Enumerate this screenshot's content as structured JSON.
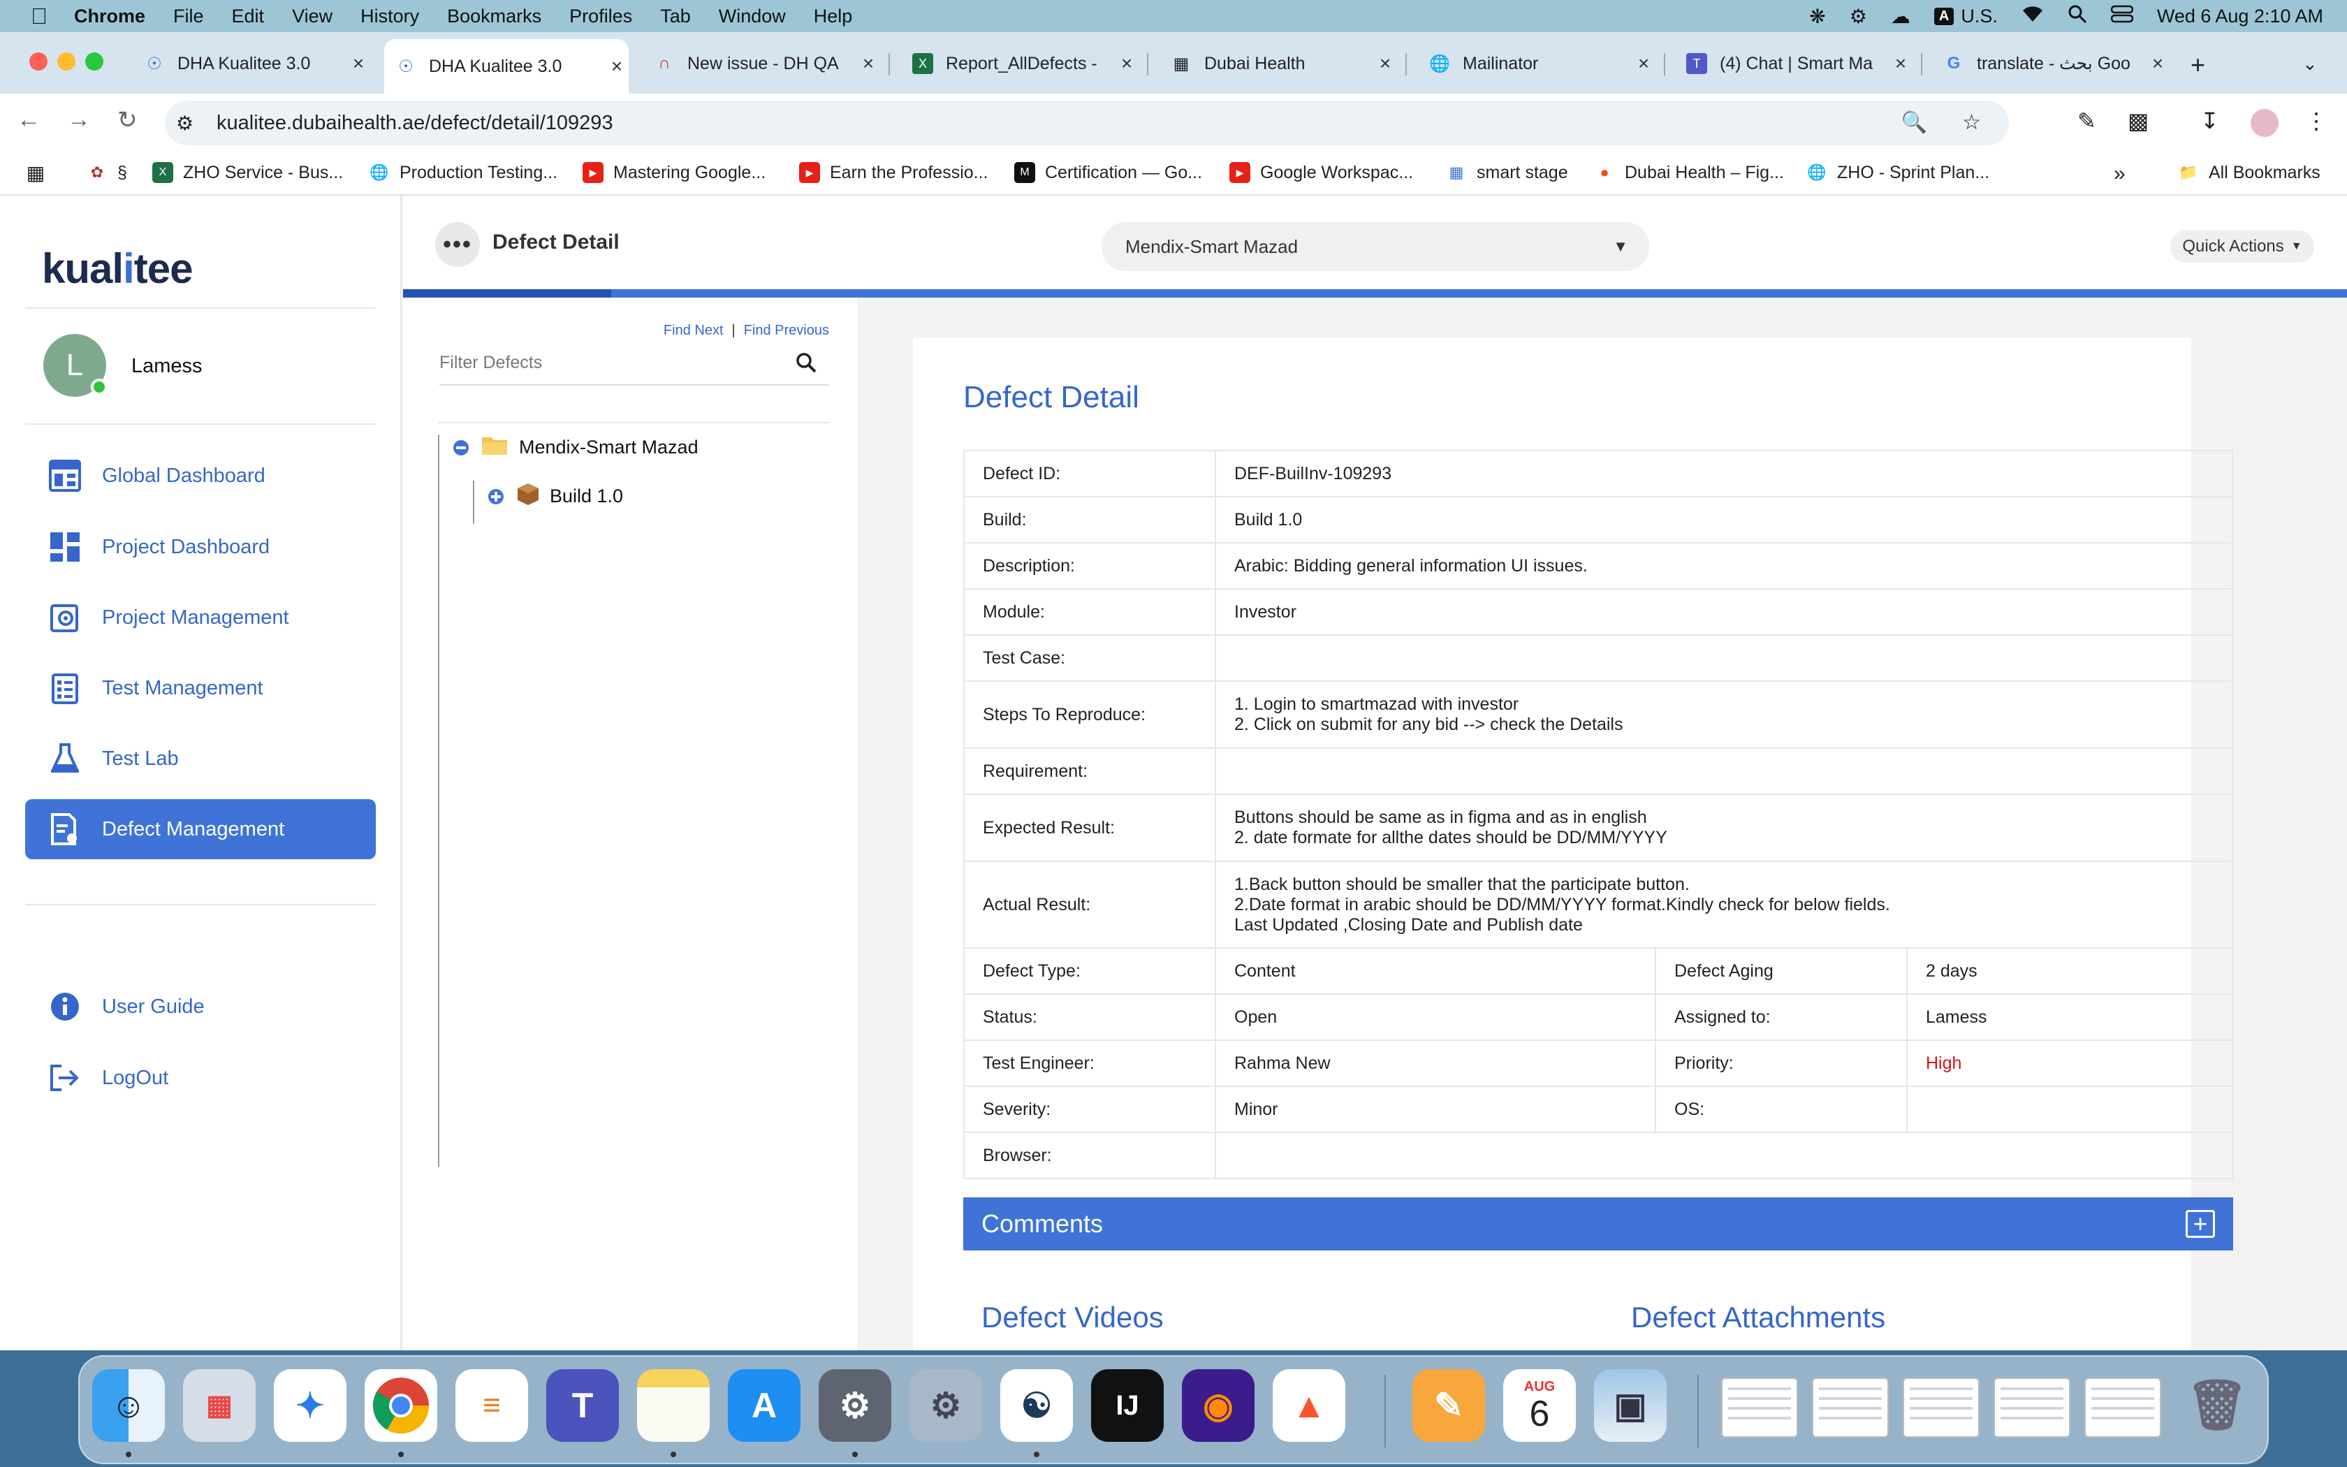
{
  "menubar": {
    "app": "Chrome",
    "items": [
      "File",
      "Edit",
      "View",
      "History",
      "Bookmarks",
      "Profiles",
      "Tab",
      "Window",
      "Help"
    ],
    "input_source": "A",
    "input_label": "U.S.",
    "datetime": "Wed 6 Aug  2:10 AM"
  },
  "tabs": [
    {
      "title": "DHA Kualitee 3.0",
      "icon": "kualitee-icon"
    },
    {
      "title": "DHA Kualitee 3.0",
      "icon": "kualitee-icon",
      "active": true
    },
    {
      "title": "New issue - DH QA",
      "icon": "issue-icon"
    },
    {
      "title": "Report_AllDefects -",
      "icon": "excel-icon"
    },
    {
      "title": "Dubai Health",
      "icon": "dubai-health-icon"
    },
    {
      "title": "Mailinator",
      "icon": "globe-icon"
    },
    {
      "title": "(4) Chat | Smart Ma",
      "icon": "teams-icon"
    },
    {
      "title": "translate - بحث Goo",
      "icon": "google-icon"
    }
  ],
  "address": {
    "url": "kualitee.dubaihealth.ae/defect/detail/109293"
  },
  "bookmarks": [
    {
      "label": "§",
      "icon": "flower-icon"
    },
    {
      "label": "ZHO Service - Bus...",
      "icon": "excel-icon"
    },
    {
      "label": "Production Testing...",
      "icon": "globe-icon"
    },
    {
      "label": "Mastering Google...",
      "icon": "youtube-icon"
    },
    {
      "label": "Earn the Professio...",
      "icon": "youtube-icon"
    },
    {
      "label": "Certification — Go...",
      "icon": "medium-icon"
    },
    {
      "label": "Google Workspac...",
      "icon": "youtube-icon"
    },
    {
      "label": "smart stage",
      "icon": "chart-icon"
    },
    {
      "label": "Dubai Health – Fig...",
      "icon": "figma-icon"
    },
    {
      "label": "ZHO - Sprint Plan...",
      "icon": "globe-icon"
    }
  ],
  "all_bookmarks": "All Bookmarks",
  "sidebar": {
    "logo_text_a": "kual",
    "logo_text_b": "i",
    "logo_text_c": "tee",
    "avatar_letter": "L",
    "user_name": "Lamess",
    "nav": [
      {
        "label": "Global Dashboard",
        "icon": "global-dashboard-icon"
      },
      {
        "label": "Project Dashboard",
        "icon": "project-dashboard-icon"
      },
      {
        "label": "Project Management",
        "icon": "project-management-icon"
      },
      {
        "label": "Test Management",
        "icon": "test-management-icon"
      },
      {
        "label": "Test Lab",
        "icon": "flask-icon"
      },
      {
        "label": "Defect Management",
        "icon": "defect-management-icon",
        "active": true
      }
    ],
    "footer": [
      {
        "label": "User Guide",
        "icon": "info-icon"
      },
      {
        "label": "LogOut",
        "icon": "logout-icon"
      }
    ]
  },
  "header": {
    "title": "Defect Detail",
    "project_selected": "Mendix-Smart Mazad",
    "quick_actions": "Quick Actions"
  },
  "tree": {
    "find_next": "Find Next",
    "separator": "|",
    "find_previous": "Find Previous",
    "filter_placeholder": "Filter Defects",
    "project": "Mendix-Smart Mazad",
    "build": "Build 1.0"
  },
  "detail": {
    "title": "Defect Detail",
    "defect_id_label": "Defect ID:",
    "defect_id": "DEF-BuilInv-109293",
    "build_label": "Build:",
    "build": "Build 1.0",
    "description_label": "Description:",
    "description": "Arabic: Bidding general information UI issues.",
    "module_label": "Module:",
    "module": "Investor",
    "test_case_label": "Test Case:",
    "test_case": "",
    "steps_label": "Steps To Reproduce:",
    "steps": [
      "1. Login to smartmazad with investor",
      "2. Click on submit for any bid --> check the Details"
    ],
    "requirement_label": "Requirement:",
    "requirement": "",
    "expected_label": "Expected Result:",
    "expected": [
      "Buttons should be same as in figma and as in english",
      "2. date formate for allthe dates should be DD/MM/YYYY"
    ],
    "actual_label": "Actual Result:",
    "actual": [
      "1.Back button should be smaller that the participate button.",
      "2.Date format in arabic should be DD/MM/YYYY format.Kindly check for below fields.",
      "Last Updated ,Closing Date and Publish date"
    ],
    "defect_type_label": "Defect Type:",
    "defect_type": "Content",
    "aging_label": "Defect Aging",
    "aging": "2 days",
    "status_label": "Status:",
    "status": "Open",
    "assigned_label": "Assigned to:",
    "assigned": "Lamess",
    "engineer_label": "Test Engineer:",
    "engineer": "Rahma New",
    "priority_label": "Priority:",
    "priority": "High",
    "severity_label": "Severity:",
    "severity": "Minor",
    "os_label": "OS:",
    "os": "",
    "browser_label": "Browser:",
    "browser": "",
    "comments": "Comments",
    "videos": "Defect Videos",
    "attachments": "Defect Attachments"
  },
  "dock": {
    "calendar_month": "AUG",
    "calendar_day": "6"
  },
  "colors": {
    "accent": "#3f73d8",
    "priority_high": "#d01818"
  }
}
